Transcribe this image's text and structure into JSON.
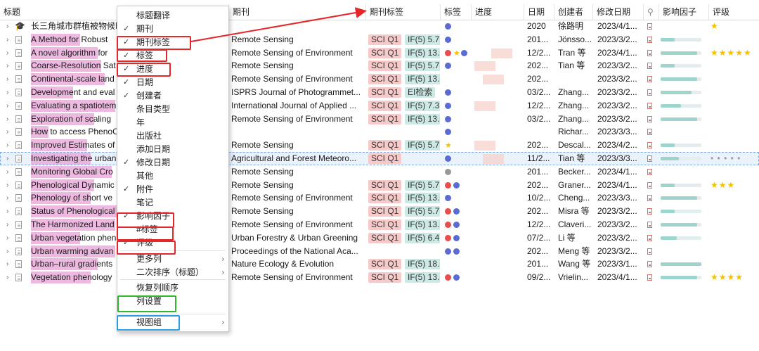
{
  "columns": {
    "title": "标题",
    "journal": "期刊",
    "journal_tag": "期刊标签",
    "tags": "标签",
    "progress": "进度",
    "date": "日期",
    "creator": "创建者",
    "modified": "修改日期",
    "impact": "影响因子",
    "rating": "评级"
  },
  "rows": [
    {
      "title": "长三角城市群植被物候时",
      "journal": "",
      "q": "",
      "if": "",
      "date": "2020",
      "creator": "徐路明",
      "modified": "2023/4/1...",
      "stars": "★",
      "ifw": 0
    },
    {
      "title": "A Method for Robust",
      "journal": "Remote Sensing",
      "q": "SCI Q1",
      "if": "IF(5) 5.78",
      "date": "201...",
      "creator": "Jönsso...",
      "modified": "2023/3/2...",
      "stars": "",
      "ifw": 0.35
    },
    {
      "title": "A novel algorithm for",
      "journal": "Remote Sensing of Environment",
      "q": "SCI Q1",
      "if": "IF(5) 13.0",
      "date": "12/2...",
      "creator": "Tran 等",
      "modified": "2023/4/1...",
      "stars": "★★★★★",
      "ifw": 0.9
    },
    {
      "title": "Coarse-Resolution Sat",
      "journal": "Remote Sensing",
      "q": "SCI Q1",
      "if": "IF(5) 5.78",
      "date": "202...",
      "creator": "Tian 等",
      "modified": "2023/3/2...",
      "stars": "",
      "ifw": 0.35
    },
    {
      "title": "Continental-scale land",
      "journal": "Remote Sensing of Environment",
      "q": "SCI Q1",
      "if": "IF(5) 13.0",
      "date": "202...",
      "creator": "",
      "modified": "2023/3/2...",
      "stars": "",
      "ifw": 0.9
    },
    {
      "title": "Development and eval",
      "journal": "ISPRS Journal of Photogrammet...",
      "q": "SCI Q1",
      "if": "EI检索",
      "date": "03/2...",
      "creator": "Zhang...",
      "modified": "2023/3/2...",
      "stars": "",
      "ifw": 0.75
    },
    {
      "title": "Evaluating a spatiotem",
      "journal": "International Journal of Applied ...",
      "q": "SCI Q1",
      "if": "IF(5) 7.3",
      "date": "12/2...",
      "creator": "Zhang...",
      "modified": "2023/3/2...",
      "stars": "",
      "ifw": 0.5
    },
    {
      "title": "Exploration of scaling",
      "journal": "Remote Sensing of Environment",
      "q": "SCI Q1",
      "if": "IF(5) 13.0",
      "date": "03/2...",
      "creator": "Zhang...",
      "modified": "2023/3/2...",
      "stars": "",
      "ifw": 0.9
    },
    {
      "title": "How to access PhenoC",
      "journal": "",
      "q": "",
      "if": "",
      "date": "",
      "creator": "Richar...",
      "modified": "2023/3/3...",
      "stars": "",
      "ifw": 0
    },
    {
      "title": "Improved Estimates of",
      "journal": "Remote Sensing",
      "q": "SCI Q1",
      "if": "IF(5) 5.78",
      "date": "202...",
      "creator": "Descal...",
      "modified": "2023/4/2...",
      "stars": "",
      "ifw": 0.35
    },
    {
      "title": "Investigating the urban",
      "journal": "Agricultural and Forest Meteoro...",
      "q": "SCI Q1",
      "if": "",
      "date": "11/2...",
      "creator": "Tian 等",
      "modified": "2023/3/3...",
      "stars": "• • • • •",
      "ifw": 0.45
    },
    {
      "title": "Monitoring Global Cro",
      "journal": "Remote Sensing",
      "q": "",
      "if": "",
      "date": "201...",
      "creator": "Becker...",
      "modified": "2023/4/1...",
      "stars": "",
      "ifw": 0
    },
    {
      "title": "Phenological Dynamic",
      "journal": "Remote Sensing",
      "q": "SCI Q1",
      "if": "IF(5) 5.78",
      "date": "202...",
      "creator": "Graner...",
      "modified": "2023/4/1...",
      "stars": "★★★",
      "ifw": 0.35
    },
    {
      "title": "Phenology of short ve",
      "journal": "Remote Sensing of Environment",
      "q": "SCI Q1",
      "if": "IF(5) 13.0",
      "date": "10/2...",
      "creator": "Cheng...",
      "modified": "2023/3/3...",
      "stars": "",
      "ifw": 0.9
    },
    {
      "title": "Status of Phenological",
      "journal": "Remote Sensing",
      "q": "SCI Q1",
      "if": "IF(5) 5.78",
      "date": "202...",
      "creator": "Misra 等",
      "modified": "2023/3/2...",
      "stars": "",
      "ifw": 0.35
    },
    {
      "title": "The Harmonized Land",
      "journal": "Remote Sensing of Environment",
      "q": "SCI Q1",
      "if": "IF(5) 13.0",
      "date": "12/2...",
      "creator": "Claveri...",
      "modified": "2023/3/2...",
      "stars": "",
      "ifw": 0.9
    },
    {
      "title": "Urban vegetation phen",
      "journal": "Urban Forestry & Urban Greening",
      "q": "SCI Q1",
      "if": "IF(5) 6.4",
      "date": "07/2...",
      "creator": "Li 等",
      "modified": "2023/3/2...",
      "stars": "",
      "ifw": 0.4
    },
    {
      "title": "Urban warming advan",
      "journal": "Proceedings of the National Aca...",
      "q": "",
      "if": "",
      "date": "202...",
      "creator": "Meng 等",
      "modified": "2023/3/2...",
      "stars": "",
      "ifw": 0
    },
    {
      "title": "Urban–rural gradients",
      "journal": "Nature Ecology & Evolution",
      "q": "SCI Q1",
      "if": "IF(5) 18.0",
      "date": "201...",
      "creator": "Wang 等",
      "modified": "2023/3/1...",
      "stars": "",
      "ifw": 1.0
    },
    {
      "title": "Vegetation phenology",
      "journal": "Remote Sensing of Environment",
      "q": "SCI Q1",
      "if": "IF(5) 13.0",
      "date": "09/2...",
      "creator": "Vrielin...",
      "modified": "2023/4/1...",
      "stars": "★★★★",
      "ifw": 0.9
    }
  ],
  "menu": [
    {
      "label": "标题翻译",
      "checked": false
    },
    {
      "label": "期刊",
      "checked": true
    },
    {
      "label": "期刊标签",
      "checked": true
    },
    {
      "label": "标签",
      "checked": true
    },
    {
      "label": "进度",
      "checked": true
    },
    {
      "label": "日期",
      "checked": true
    },
    {
      "label": "创建者",
      "checked": true
    },
    {
      "label": "条目类型",
      "checked": false
    },
    {
      "label": "年",
      "checked": false
    },
    {
      "label": "出版社",
      "checked": false
    },
    {
      "label": "添加日期",
      "checked": false
    },
    {
      "label": "修改日期",
      "checked": true
    },
    {
      "label": "其他",
      "checked": false
    },
    {
      "label": "附件",
      "checked": true
    },
    {
      "label": "笔记",
      "checked": false
    },
    {
      "label": "影响因子",
      "checked": true
    },
    {
      "label": "#标签",
      "checked": false
    },
    {
      "label": "评级",
      "checked": true
    },
    {
      "label": "更多列",
      "checked": false,
      "submenu": true
    },
    {
      "label": "二次排序（标题）",
      "checked": false,
      "submenu": true
    },
    {
      "label": "恢复列顺序",
      "checked": false
    },
    {
      "label": "列设置",
      "checked": false
    },
    {
      "label": "视图组",
      "checked": false,
      "submenu": true
    }
  ],
  "colors": {
    "red": "#e5262b",
    "green": "#2db82d",
    "blue": "#2a9be8",
    "q_tag": "#f8c9c9",
    "if_tag": "#cde9e5",
    "dot_blue": "#5b6bd6",
    "dot_red": "#ea4b4b",
    "star": "#f2c200"
  }
}
